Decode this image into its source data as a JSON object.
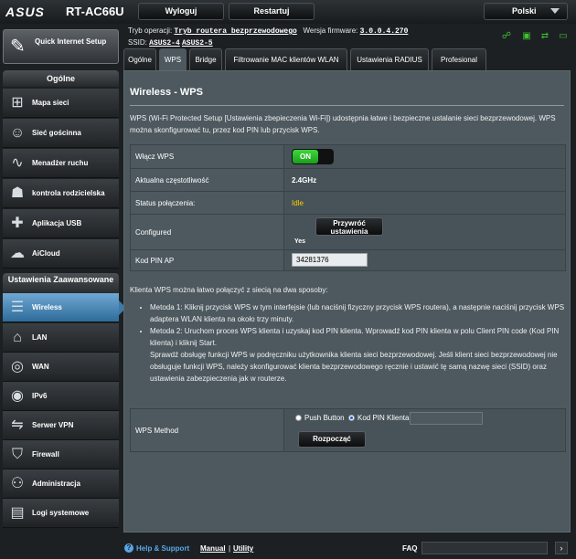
{
  "header": {
    "logo": "ASUS",
    "model": "RT-AC66U",
    "logout_label": "Wyloguj",
    "restart_label": "Restartuj",
    "language": "Polski"
  },
  "status": {
    "mode_label": "Tryb operacji:",
    "mode_value": "Tryb routera bezprzewodowego",
    "firmware_label": "Wersja firmware:",
    "firmware_value": "3.0.0.4.270",
    "ssid_label": "SSID:",
    "ssid_1": "ASUS2-4",
    "ssid_2": "ASUS2-5"
  },
  "sidebar": {
    "quick_setup": "Quick Internet Setup",
    "general_title": "Ogólne",
    "general_items": [
      {
        "label": "Mapa sieci",
        "icon": "network-map-icon"
      },
      {
        "label": "Sieć gościnna",
        "icon": "guest-network-icon"
      },
      {
        "label": "Menadżer ruchu",
        "icon": "traffic-manager-icon"
      },
      {
        "label": "kontrola rodzicielska",
        "icon": "parental-control-icon"
      },
      {
        "label": "Aplikacja USB",
        "icon": "usb-application-icon"
      },
      {
        "label": "AiCloud",
        "icon": "aicloud-icon"
      }
    ],
    "advanced_title": "Ustawienia Zaawansowane",
    "advanced_items": [
      {
        "label": "Wireless",
        "icon": "wireless-icon",
        "active": true
      },
      {
        "label": "LAN",
        "icon": "lan-icon"
      },
      {
        "label": "WAN",
        "icon": "wan-icon"
      },
      {
        "label": "IPv6",
        "icon": "ipv6-icon"
      },
      {
        "label": "Serwer VPN",
        "icon": "vpn-icon"
      },
      {
        "label": "Firewall",
        "icon": "firewall-icon"
      },
      {
        "label": "Administracja",
        "icon": "administration-icon"
      },
      {
        "label": "Logi systemowe",
        "icon": "system-log-icon"
      }
    ]
  },
  "tabs": [
    "Ogólne",
    "WPS",
    "Bridge",
    "Filtrowanie MAC klientów WLAN",
    "Ustawienia RADIUS",
    "Profesional"
  ],
  "active_tab": "WPS",
  "page": {
    "title": "Wireless - WPS",
    "description": "WPS (Wi-Fi Protected Setup [Ustawienia zbepieczenia Wi-Fi]) udostępnia łatwe i bezpieczne ustalanie sieci bezprzewodowej. WPS można skonfigurować tu, przez kod PIN lub przycisk WPS.",
    "rows": {
      "enable_label": "Włącz WPS",
      "enable_value": "ON",
      "frequency_label": "Aktualna częstotliwość",
      "frequency_value": "2.4GHz",
      "connection_label": "Status połączenia:",
      "connection_value": "Idle",
      "configured_label": "Configured",
      "restore_button": "Przywróć ustawienia",
      "configured_value": "Yes",
      "pin_label": "Kod PIN AP",
      "pin_value": "34281376"
    },
    "methods_intro": "Klienta WPS można łatwo połączyć z siecią na dwa sposoby:",
    "method_1": "Metoda 1: Kliknij przycisk WPS w tym interfejsie (lub naciśnij fizyczny przycisk WPS routera), a następnie naciśnij przycisk WPS adaptera WLAN klienta na około trzy minuty.",
    "method_2": "Metoda 2: Uruchom proces WPS klienta i uzyskaj kod PIN klienta. Wprowadź kod PIN klienta w polu Client PIN code (Kod PIN klienta) i kliknij Start.",
    "method_2_note": "Sprawdź obsługę funkcji WPS w podręczniku użytkownika klienta sieci bezprzewodowej. Jeśli klient sieci bezprzewodowej nie obsługuje funkcji WPS, należy skonfigurować klienta bezprzewodowego ręcznie i ustawić tę samą nazwę sieci (SSID) oraz ustawienia zabezpieczenia jak w routerze.",
    "wps_method_label": "WPS Method",
    "push_button_label": "Push Button",
    "client_pin_label": "Kod PIN Klienta",
    "client_pin_value": "",
    "start_button": "Rozpocząć"
  },
  "footer": {
    "help": "Help & Support",
    "manual": "Manual",
    "separator": "|",
    "utility": "Utility",
    "faq": "FAQ",
    "faq_value": ""
  },
  "colors": {
    "background": "#1c2023",
    "panel": "#4d595f",
    "active_nav": "#3e7aa8",
    "toggle_on": "#2bbd2b",
    "idle_status": "#ffcc00",
    "status_icons": "#3fc32f"
  }
}
